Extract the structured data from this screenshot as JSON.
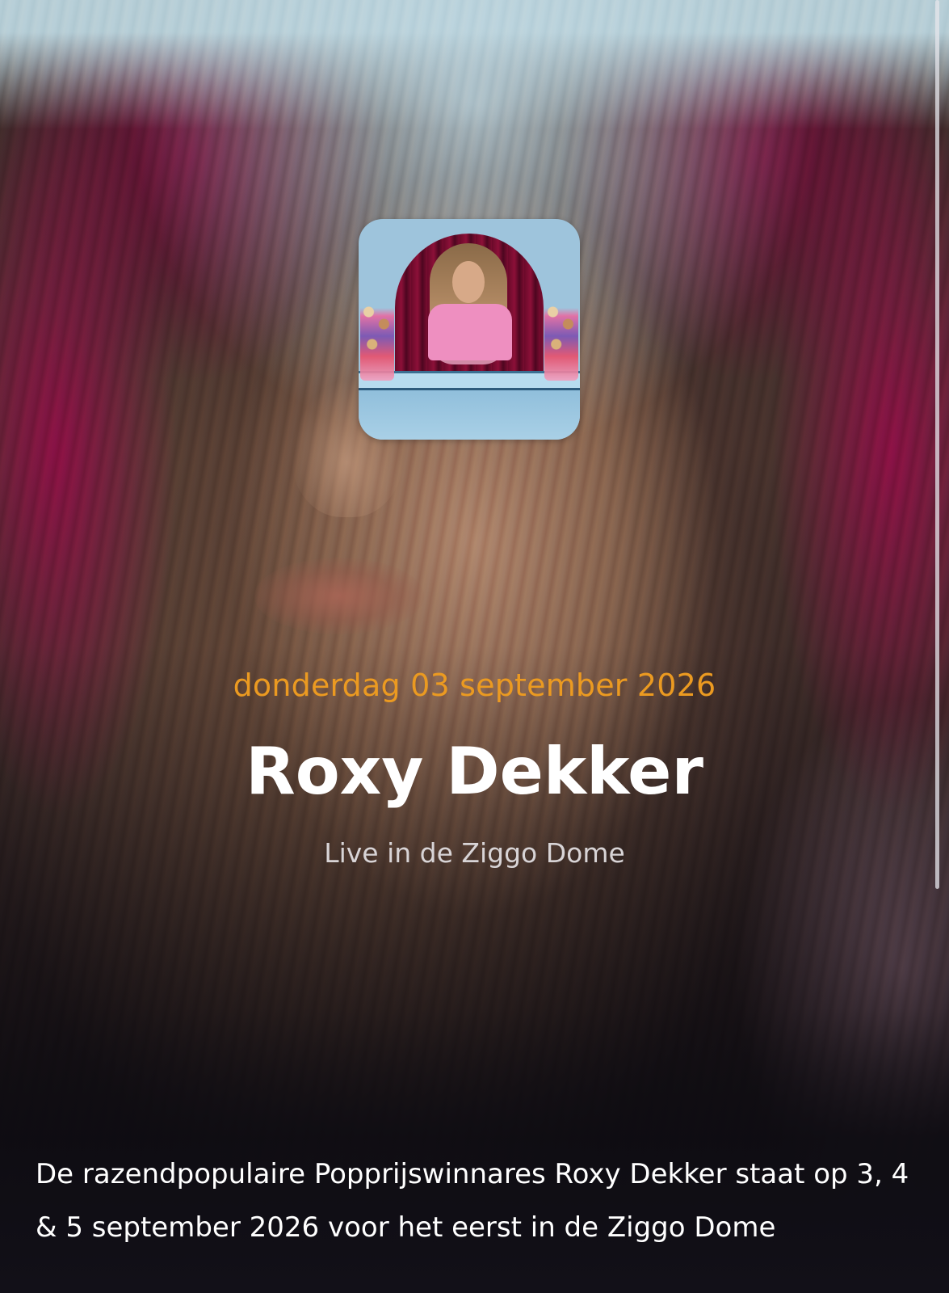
{
  "event": {
    "date": "donderdag 03 september 2026",
    "artist": "Roxy Dekker",
    "venue_line": "Live in de Ziggo Dome",
    "description": "De razendpopulaire Popprijswinnares Roxy Dekker staat op 3, 4 & 5 september 2026 voor het eerst in de Ziggo Dome"
  },
  "colors": {
    "date_accent": "#eb9a21",
    "title": "#ffffff",
    "subtitle": "#d8d4d6",
    "background_bottom": "#121018"
  },
  "icons": {
    "app_icon": "album-cover-image"
  }
}
